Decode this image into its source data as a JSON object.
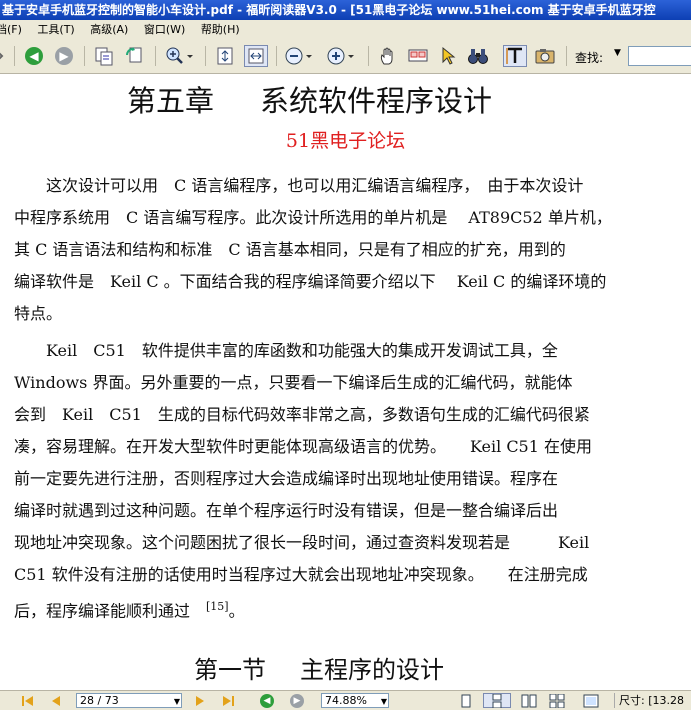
{
  "window": {
    "title": "基于安卓手机蓝牙控制的智能小车设计.pdf - 福昕阅读器V3.0 - [51黑电子论坛 www.51hei.com 基于安卓手机蓝牙控"
  },
  "menu": {
    "items": [
      "档(F)",
      "工具(T)",
      "高级(A)",
      "窗口(W)",
      "帮助(H)"
    ]
  },
  "toolbar": {
    "find_label": "查找:",
    "find_value": ""
  },
  "document": {
    "chapter_num": "第五章",
    "chapter_title": "系统软件程序设计",
    "subtitle": "51黑电子论坛",
    "paragraph1": [
      "　　这次设计可以用　C 语言编程序，也可以用汇编语言编程序，　由于本次设计",
      "中程序系统用　C 语言编写程序。此次设计所选用的单片机是　 AT89C52 单片机，",
      "其 C 语言语法和结构和标准　C 语言基本相同，只是有了相应的扩充，用到的",
      "编译软件是　Keil C 。下面结合我的程序编译简要介绍以下　 Keil C 的编译环境的",
      "特点。"
    ],
    "paragraph2": [
      "　　Keil　C51　软件提供丰富的库函数和功能强大的集成开发调试工具，全",
      "Windows 界面。另外重要的一点，只要看一下编译后生成的汇编代码，就能体",
      "会到　Keil　C51　生成的目标代码效率非常之高，多数语句生成的汇编代码很紧",
      "凑，容易理解。在开发大型软件时更能体现高级语言的优势。　　Keil C51 在使用",
      "前一定要先进行注册，否则程序过大会造成编译时出现地址使用错误。程序在",
      "编译时就遇到过这种问题。在单个程序运行时没有错误，但是一整合编译后出",
      "现地址冲突现象。这个问题困扰了很长一段时间，通过查资料发现若是　　　Keil",
      "C51 软件没有注册的话使用时当程序过大就会出现地址冲突现象。　　在注册完成",
      "后，程序编译能顺利通过　"
    ],
    "citation": "[15]",
    "paragraph2_end": "。",
    "section_num": "第一节",
    "section_title": "主程序的设计"
  },
  "statusbar": {
    "page_field": "28 / 73",
    "zoom_field": "74.88%",
    "size_label": "尺寸: [13.28"
  },
  "colors": {
    "title_bar": "#1a4fc4",
    "chrome": "#ece9d8",
    "subtitle_red": "#e02020",
    "nav_green": "#2e9e3c"
  }
}
